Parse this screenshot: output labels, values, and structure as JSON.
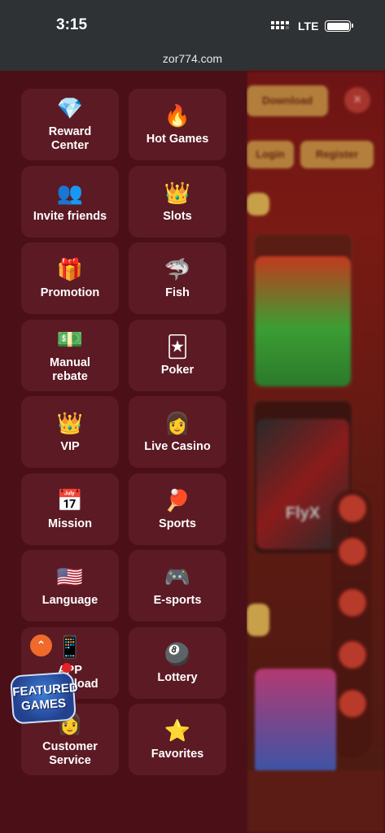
{
  "status": {
    "time": "3:15",
    "network": "LTE"
  },
  "browser": {
    "url": "zor774.com"
  },
  "background": {
    "download": "Download",
    "login": "Login",
    "register": "Register",
    "close_symbol": "×",
    "game_label": "FlyX"
  },
  "menu": [
    {
      "label": "Reward Center",
      "icon": "diamond-icon",
      "glyph": "💎"
    },
    {
      "label": "Hot Games",
      "icon": "fire-icon",
      "glyph": "🔥"
    },
    {
      "label": "Invite friends",
      "icon": "people-icon",
      "glyph": "👥"
    },
    {
      "label": "Slots",
      "icon": "crown-slots-icon",
      "glyph": "👑"
    },
    {
      "label": "Promotion",
      "icon": "gift-icon",
      "glyph": "🎁"
    },
    {
      "label": "Fish",
      "icon": "shark-icon",
      "glyph": "🦈"
    },
    {
      "label": "Manual rebate",
      "icon": "money-icon",
      "glyph": "💵"
    },
    {
      "label": "Poker",
      "icon": "cards-icon",
      "glyph": "🃏"
    },
    {
      "label": "VIP",
      "icon": "crown-icon",
      "glyph": "👑"
    },
    {
      "label": "Live Casino",
      "icon": "dealer-icon",
      "glyph": "👩"
    },
    {
      "label": "Mission",
      "icon": "calendar-icon",
      "glyph": "📅"
    },
    {
      "label": "Sports",
      "icon": "sports-icon",
      "glyph": "🏓"
    },
    {
      "label": "Language",
      "icon": "us-flag-icon",
      "glyph": "🇺🇸"
    },
    {
      "label": "E-sports",
      "icon": "gamepad-icon",
      "glyph": "🎮"
    },
    {
      "label": "APP Download",
      "icon": "app-icon",
      "glyph": "📱"
    },
    {
      "label": "Lottery",
      "icon": "lottery-icon",
      "glyph": "🎱"
    },
    {
      "label": "Customer Service",
      "icon": "support-icon",
      "glyph": "👩"
    },
    {
      "label": "Favorites",
      "icon": "star-icon",
      "glyph": "⭐"
    }
  ],
  "featured": {
    "line1": "FEATURED",
    "line2": "GAMES",
    "scroll_symbol": "⌃"
  }
}
